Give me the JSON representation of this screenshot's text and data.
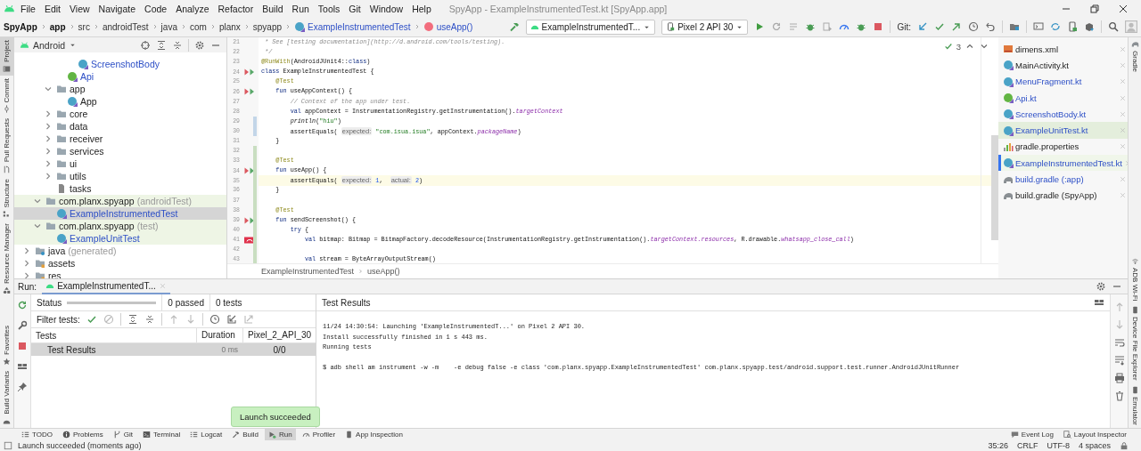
{
  "menu_bar": {
    "items": [
      "File",
      "Edit",
      "View",
      "Navigate",
      "Code",
      "Analyze",
      "Refactor",
      "Build",
      "Run",
      "Tools",
      "Git",
      "Window",
      "Help"
    ],
    "title": "SpyApp - ExampleInstrumentedTest.kt [SpyApp.app]"
  },
  "nav_bar": {
    "crumbs": [
      {
        "label": "SpyApp",
        "kind": "module"
      },
      {
        "label": "app",
        "kind": "module"
      },
      {
        "label": "src",
        "kind": "dir"
      },
      {
        "label": "androidTest",
        "kind": "dir"
      },
      {
        "label": "java",
        "kind": "dir"
      },
      {
        "label": "com",
        "kind": "dir"
      },
      {
        "label": "planx",
        "kind": "dir"
      },
      {
        "label": "spyapp",
        "kind": "dir"
      },
      {
        "label": "ExampleInstrumentedTest",
        "kind": "class"
      },
      {
        "label": "useApp()",
        "kind": "method"
      }
    ]
  },
  "toolbar": {
    "run_config": "ExampleInstrumentedT...",
    "device": "Pixel 2 API 30",
    "git_label": "Git:"
  },
  "left_stripe_top": [
    {
      "label": "Project",
      "selected": true
    },
    {
      "label": "Commit",
      "selected": false
    },
    {
      "label": "Pull Requests",
      "selected": false
    },
    {
      "label": "Structure",
      "selected": false
    },
    {
      "label": "Resource Manager",
      "selected": false
    }
  ],
  "left_stripe_bottom": [
    {
      "label": "Favorites",
      "selected": false
    },
    {
      "label": "Build Variants",
      "selected": false
    }
  ],
  "project": {
    "view": "Android",
    "tree": [
      {
        "children": [
          {
            "children": [
              {
                "children": [
                  {
                    "children": [
                      {
                        "label": "ScreenshotBody",
                        "kind": "class",
                        "modified": true,
                        "selected": false
                      }
                    ]
                  },
                  {
                    "label": "Api",
                    "kind": "class-green",
                    "modified": true,
                    "selected": false
                  }
                ]
              },
              {
                "label": "app",
                "kind": "folder",
                "expanded": true,
                "selected": false,
                "children": [
                  {
                    "label": "App",
                    "kind": "class",
                    "selected": false
                  }
                ]
              },
              {
                "label": "core",
                "kind": "folder",
                "expanded": false,
                "selected": false
              },
              {
                "label": "data",
                "kind": "folder",
                "expanded": false,
                "selected": false
              },
              {
                "label": "receiver",
                "kind": "folder",
                "expanded": false,
                "selected": false
              },
              {
                "label": "services",
                "kind": "folder",
                "expanded": false,
                "selected": false
              },
              {
                "label": "ui",
                "kind": "folder",
                "expanded": false,
                "selected": false
              },
              {
                "label": "utils",
                "kind": "folder",
                "expanded": false,
                "selected": false
              },
              {
                "label": "tasks",
                "kind": "file",
                "selected": false
              }
            ]
          },
          {
            "label": "com.planx.spyapp",
            "note": "(androidTest)",
            "kind": "folder",
            "expanded": true,
            "tinted": true,
            "selected": false,
            "children": [
              {
                "label": "ExampleInstrumentedTest",
                "kind": "class",
                "modified": true,
                "selected": true
              }
            ]
          },
          {
            "label": "com.planx.spyapp",
            "note": "(test)",
            "kind": "folder",
            "expanded": true,
            "tinted": true,
            "selected": false,
            "children": [
              {
                "label": "ExampleUnitTest",
                "kind": "class",
                "modified": true,
                "tinted": true,
                "selected": false
              }
            ]
          }
        ]
      },
      {
        "label": "java",
        "note": "(generated)",
        "kind": "folder-gen",
        "expanded": false,
        "selected": false
      },
      {
        "label": "assets",
        "kind": "folder-res",
        "expanded": false,
        "selected": false
      },
      {
        "label": "res",
        "kind": "folder-res",
        "expanded": false,
        "selected": false
      }
    ]
  },
  "editor": {
    "inspections": "3",
    "lines": [
      {
        "n": "21",
        "segs": [
          {
            "kind": "cm",
            "text": " * See [testing documentation](http://d.android.com/tools/testing)."
          }
        ]
      },
      {
        "n": "22",
        "segs": [
          {
            "kind": "cm",
            "text": " */"
          }
        ]
      },
      {
        "n": "23",
        "segs": [
          {
            "kind": "ann",
            "text": "@RunWith"
          },
          {
            "kind": "p",
            "text": "(AndroidJUnit4::"
          },
          {
            "kind": "kw",
            "text": "class"
          },
          {
            "kind": "p",
            "text": ")"
          }
        ]
      },
      {
        "n": "24",
        "kind": "run",
        "segs": [
          {
            "kind": "kw",
            "text": "class "
          },
          {
            "kind": "p",
            "text": "ExampleInstrumentedTest {"
          }
        ]
      },
      {
        "n": "25",
        "segs": [
          {
            "kind": "ann",
            "text": "    @Test"
          }
        ]
      },
      {
        "n": "26",
        "kind": "run",
        "segs": [
          {
            "kind": "kw",
            "text": "    fun "
          },
          {
            "kind": "p",
            "text": "useAppContext() {"
          }
        ]
      },
      {
        "n": "27",
        "segs": [
          {
            "kind": "cm",
            "text": "        // Context of the app under test."
          }
        ]
      },
      {
        "n": "28",
        "segs": [
          {
            "kind": "kw",
            "text": "        val "
          },
          {
            "kind": "p",
            "text": "appContext = InstrumentationRegistry.getInstrumentation()."
          },
          {
            "kind": "prop",
            "text": "targetContext"
          }
        ]
      },
      {
        "n": "29",
        "color": "#c3d6e8",
        "segs": [
          {
            "kind": "fn",
            "text": "        println"
          },
          {
            "kind": "p",
            "text": "("
          },
          {
            "kind": "str",
            "text": "\"hiu\""
          },
          {
            "kind": "p",
            "text": ")"
          }
        ]
      },
      {
        "n": "30",
        "color": "#c3d6e8",
        "segs": [
          {
            "kind": "p",
            "text": "        assertEquals( "
          },
          {
            "kind": "hint",
            "text": "expected:"
          },
          {
            "kind": "str",
            "text": " \"com.isua.isua\""
          },
          {
            "kind": "p",
            "text": ", appContext."
          },
          {
            "kind": "prop",
            "text": "packageName"
          },
          {
            "kind": "p",
            "text": ")"
          }
        ]
      },
      {
        "n": "31",
        "segs": [
          {
            "kind": "p",
            "text": "    }"
          }
        ]
      },
      {
        "n": "32",
        "color": "#c9dec1"
      },
      {
        "n": "33",
        "color": "#c9dec1",
        "segs": [
          {
            "kind": "ann",
            "text": "    @Test"
          }
        ]
      },
      {
        "n": "34",
        "color": "#c9dec1",
        "kind": "run",
        "segs": [
          {
            "kind": "kw",
            "text": "    fun "
          },
          {
            "kind": "p",
            "text": "useApp() {"
          }
        ]
      },
      {
        "n": "35",
        "color": "#c9dec1",
        "current": true,
        "segs": [
          {
            "kind": "p",
            "text": "        assertEquals( "
          },
          {
            "kind": "hint",
            "text": "expected:"
          },
          {
            "kind": "num",
            "text": " 1"
          },
          {
            "kind": "p",
            "text": ",  "
          },
          {
            "kind": "hint",
            "text": "actual:"
          },
          {
            "kind": "num",
            "text": " 2"
          },
          {
            "kind": "p",
            "text": ")"
          }
        ]
      },
      {
        "n": "36",
        "color": "#c9dec1",
        "segs": [
          {
            "kind": "p",
            "text": "    }"
          }
        ]
      },
      {
        "n": "37",
        "color": "#c9dec1"
      },
      {
        "n": "38",
        "color": "#c9dec1",
        "segs": [
          {
            "kind": "ann",
            "text": "    @Test"
          }
        ]
      },
      {
        "n": "39",
        "color": "#c9dec1",
        "kind": "run",
        "segs": [
          {
            "kind": "kw",
            "text": "    fun "
          },
          {
            "kind": "p",
            "text": "sendScreenshot() {"
          }
        ]
      },
      {
        "n": "40",
        "color": "#c9dec1",
        "segs": [
          {
            "kind": "kw",
            "text": "        try "
          },
          {
            "kind": "p",
            "text": "{"
          }
        ]
      },
      {
        "n": "41",
        "color": "#c9dec1",
        "kind": "error",
        "segs": [
          {
            "kind": "kw",
            "text": "            val "
          },
          {
            "kind": "p",
            "text": "bitmap: Bitmap = BitmapFactory.decodeResource(InstrumentationRegistry.getInstrumentation()."
          },
          {
            "kind": "prop",
            "text": "targetContext.resources"
          },
          {
            "kind": "p",
            "text": ", R.drawable."
          },
          {
            "kind": "prop",
            "text": "whatsapp_close_call"
          },
          {
            "kind": "p",
            "text": ")"
          }
        ]
      },
      {
        "n": "42",
        "color": "#c9dec1"
      },
      {
        "n": "43",
        "color": "#c9dec1",
        "segs": [
          {
            "kind": "kw",
            "text": "            val "
          },
          {
            "kind": "p",
            "text": "stream = ByteArrayOutputStream()"
          }
        ]
      }
    ],
    "breadcrumbs": [
      "ExampleInstrumentedTest",
      "useApp()"
    ]
  },
  "open_files": [
    {
      "name": "dimens.xml",
      "kind": "xml",
      "modified": false,
      "selected": false
    },
    {
      "name": "MainActivity.kt",
      "kind": "class",
      "modified": false,
      "selected": false
    },
    {
      "name": "MenuFragment.kt",
      "kind": "class",
      "modified": true,
      "selected": false
    },
    {
      "name": "Api.kt",
      "kind": "class-green",
      "modified": true,
      "selected": false
    },
    {
      "name": "ScreenshotBody.kt",
      "kind": "class",
      "modified": true,
      "selected": false
    },
    {
      "name": "ExampleUnitTest.kt",
      "kind": "class",
      "modified": true,
      "tinted": true,
      "selected": false
    },
    {
      "name": "gradle.properties",
      "kind": "props",
      "modified": false,
      "selected": false
    },
    {
      "name": "ExampleInstrumentedTest.kt",
      "kind": "class",
      "modified": true,
      "tinted": true,
      "selected": true
    },
    {
      "name": "build.gradle (:app)",
      "kind": "gradle",
      "modified": true,
      "selected": false
    },
    {
      "name": "build.gradle (SpyApp)",
      "kind": "gradle",
      "modified": false,
      "selected": false
    }
  ],
  "right_stripe_top": [
    "Gradle"
  ],
  "right_stripe_bottom": [
    "ADB Wi-Fi",
    "Device File Explorer",
    "Emulator"
  ],
  "run": {
    "label": "Run:",
    "tabs": [
      {
        "label": "ExampleInstrumentedT...",
        "selected": true
      }
    ],
    "status_label": "Status",
    "level": 0,
    "passed": "0 passed",
    "tests": "0 tests",
    "filter_label": "Filter tests:",
    "columns": [
      "Tests",
      "Duration",
      "Pixel_2_API_30"
    ],
    "rows": [
      {
        "name": "Test Results",
        "duration": "0 ms",
        "result": "0/0",
        "selected": true
      }
    ],
    "console_title": "Test Results",
    "console": [
      {
        "text": "11/24 14:30:54: Launching 'ExampleInstrumentedT...' on Pixel 2 API 30.",
        "kind": "info"
      },
      {
        "text": "Install successfully finished in 1 s 443 ms.",
        "kind": "info"
      },
      {
        "text": "Running tests",
        "kind": "info"
      },
      {
        "text": "$ adb shell am instrument -w -m    -e debug false -e class 'com.planx.spyapp.ExampleInstrumentedTest' com.planx.spyapp.test/android.support.test.runner.AndroidJUnitRunner",
        "kind": "command"
      }
    ]
  },
  "toast": "Launch succeeded",
  "tool_windows": [
    {
      "label": "TODO",
      "selected": false
    },
    {
      "label": "Problems",
      "selected": false
    },
    {
      "label": "Git",
      "selected": false
    },
    {
      "label": "Terminal",
      "selected": false
    },
    {
      "label": "Logcat",
      "selected": false
    },
    {
      "label": "Build",
      "selected": false
    },
    {
      "label": "Run",
      "selected": true
    },
    {
      "label": "Profiler",
      "selected": false
    },
    {
      "label": "App Inspection",
      "selected": false
    }
  ],
  "tool_windows_right": [
    "Event Log",
    "Layout Inspector"
  ],
  "status_bar": {
    "message": "Launch succeeded (moments ago)",
    "items": [
      "35:26",
      "CRLF",
      "UTF-8",
      "4 spaces"
    ]
  }
}
